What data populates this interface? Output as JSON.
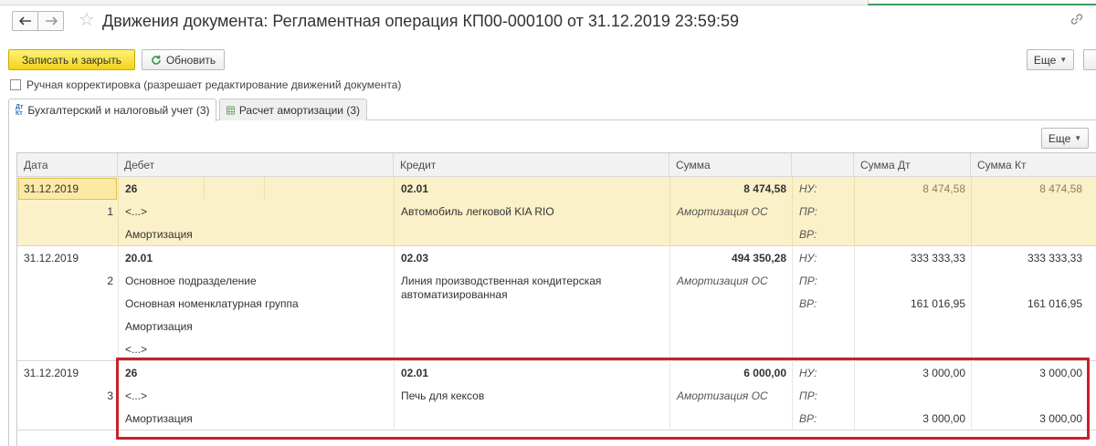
{
  "window": {
    "title": "Движения документа: Регламентная операция КП00-000100 от 31.12.2019 23:59:59"
  },
  "toolbar": {
    "save_close_label": "Записать и закрыть",
    "refresh_label": "Обновить",
    "more_label": "Еще"
  },
  "manual_correction_label": "Ручная корректировка (разрешает редактирование движений документа)",
  "tabs": [
    {
      "label": "Бухгалтерский и налоговый учет (3)",
      "active": true
    },
    {
      "label": "Расчет амортизации (3)",
      "active": false
    }
  ],
  "grid": {
    "more_label": "Еще",
    "headers": {
      "date": "Дата",
      "debit": "Дебет",
      "credit": "Кредит",
      "sum": "Сумма",
      "sum_dt": "Сумма Дт",
      "sum_kt": "Сумма Кт"
    },
    "rows": [
      {
        "date": "31.12.2019",
        "num": "1",
        "debit_account": "26",
        "debit_sub1": "<...>",
        "debit_sub2": "Амортизация",
        "credit_account": "02.01",
        "credit_sub1": "Автомобиль легковой KIA RIO",
        "sum": "8 474,58",
        "sum_type": "Амортизация ОС",
        "nu_label": "НУ:",
        "pr_label": "ПР:",
        "vr_label": "ВР:",
        "nu_dt": "8 474,58",
        "nu_kt": "8 474,58"
      },
      {
        "date": "31.12.2019",
        "num": "2",
        "debit_account": "20.01",
        "debit_sub1": "Основное подразделение",
        "debit_sub2": "Основная номенклатурная группа",
        "debit_sub3": "Амортизация",
        "debit_sub4": "<...>",
        "credit_account": "02.03",
        "credit_sub1_line1": "Линия производственная кондитерская",
        "credit_sub1_line2": "автоматизированная",
        "sum": "494 350,28",
        "sum_type": "Амортизация ОС",
        "nu_label": "НУ:",
        "pr_label": "ПР:",
        "vr_label": "ВР:",
        "nu_dt": "333 333,33",
        "nu_kt": "333 333,33",
        "vr_dt": "161 016,95",
        "vr_kt": "161 016,95"
      },
      {
        "date": "31.12.2019",
        "num": "3",
        "debit_account": "26",
        "debit_sub1": "<...>",
        "debit_sub2": "Амортизация",
        "credit_account": "02.01",
        "credit_sub1": "Печь для кексов",
        "sum": "6 000,00",
        "sum_type": "Амортизация ОС",
        "nu_label": "НУ:",
        "pr_label": "ПР:",
        "vr_label": "ВР:",
        "nu_dt": "3 000,00",
        "nu_kt": "3 000,00",
        "vr_dt": "3 000,00",
        "vr_kt": "3 000,00"
      }
    ]
  },
  "colors": {
    "primary_button": "#f3d21a",
    "selected_row": "#fbf1c8",
    "highlight_frame": "#c8202c"
  }
}
